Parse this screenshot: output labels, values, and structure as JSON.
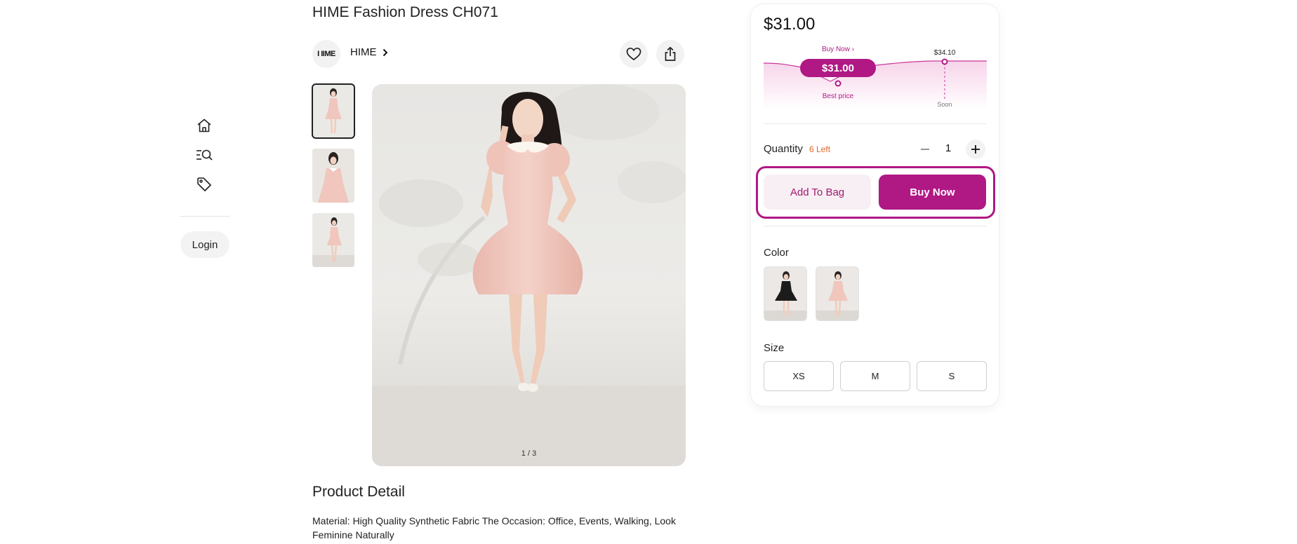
{
  "nav": {
    "items": [
      {
        "icon": "home-icon"
      },
      {
        "icon": "search-list-icon"
      },
      {
        "icon": "tag-icon"
      }
    ],
    "login_label": "Login"
  },
  "product": {
    "title": "HIME Fashion Dress CH071",
    "brand_logo_text": "I IIME",
    "brand_name": "HIME",
    "image_counter": "1 / 3",
    "detail_title": "Product Detail",
    "detail_text": "Material: High Quality Synthetic Fabric The Occasion: Office, Events, Walking, Look Feminine Naturally"
  },
  "purchase": {
    "price": "$31.00",
    "price_chart": {
      "buy_now_label": "Buy Now ›",
      "current_price": "$31.00",
      "best_price_label": "Best price",
      "future_price": "$34.10",
      "soon_label": "Soon"
    },
    "quantity_label": "Quantity",
    "stock_left": "6 Left",
    "quantity": "1",
    "add_to_bag_label": "Add To Bag",
    "buy_now_label": "Buy Now",
    "color_label": "Color",
    "colors": [
      "black",
      "pink"
    ],
    "size_label": "Size",
    "sizes": [
      "XS",
      "M",
      "S"
    ]
  },
  "colors": {
    "accent": "#b01884",
    "stock_warning": "#e0652a",
    "dress_pink": "#f0c6bd",
    "dress_black": "#1c1c1c"
  }
}
